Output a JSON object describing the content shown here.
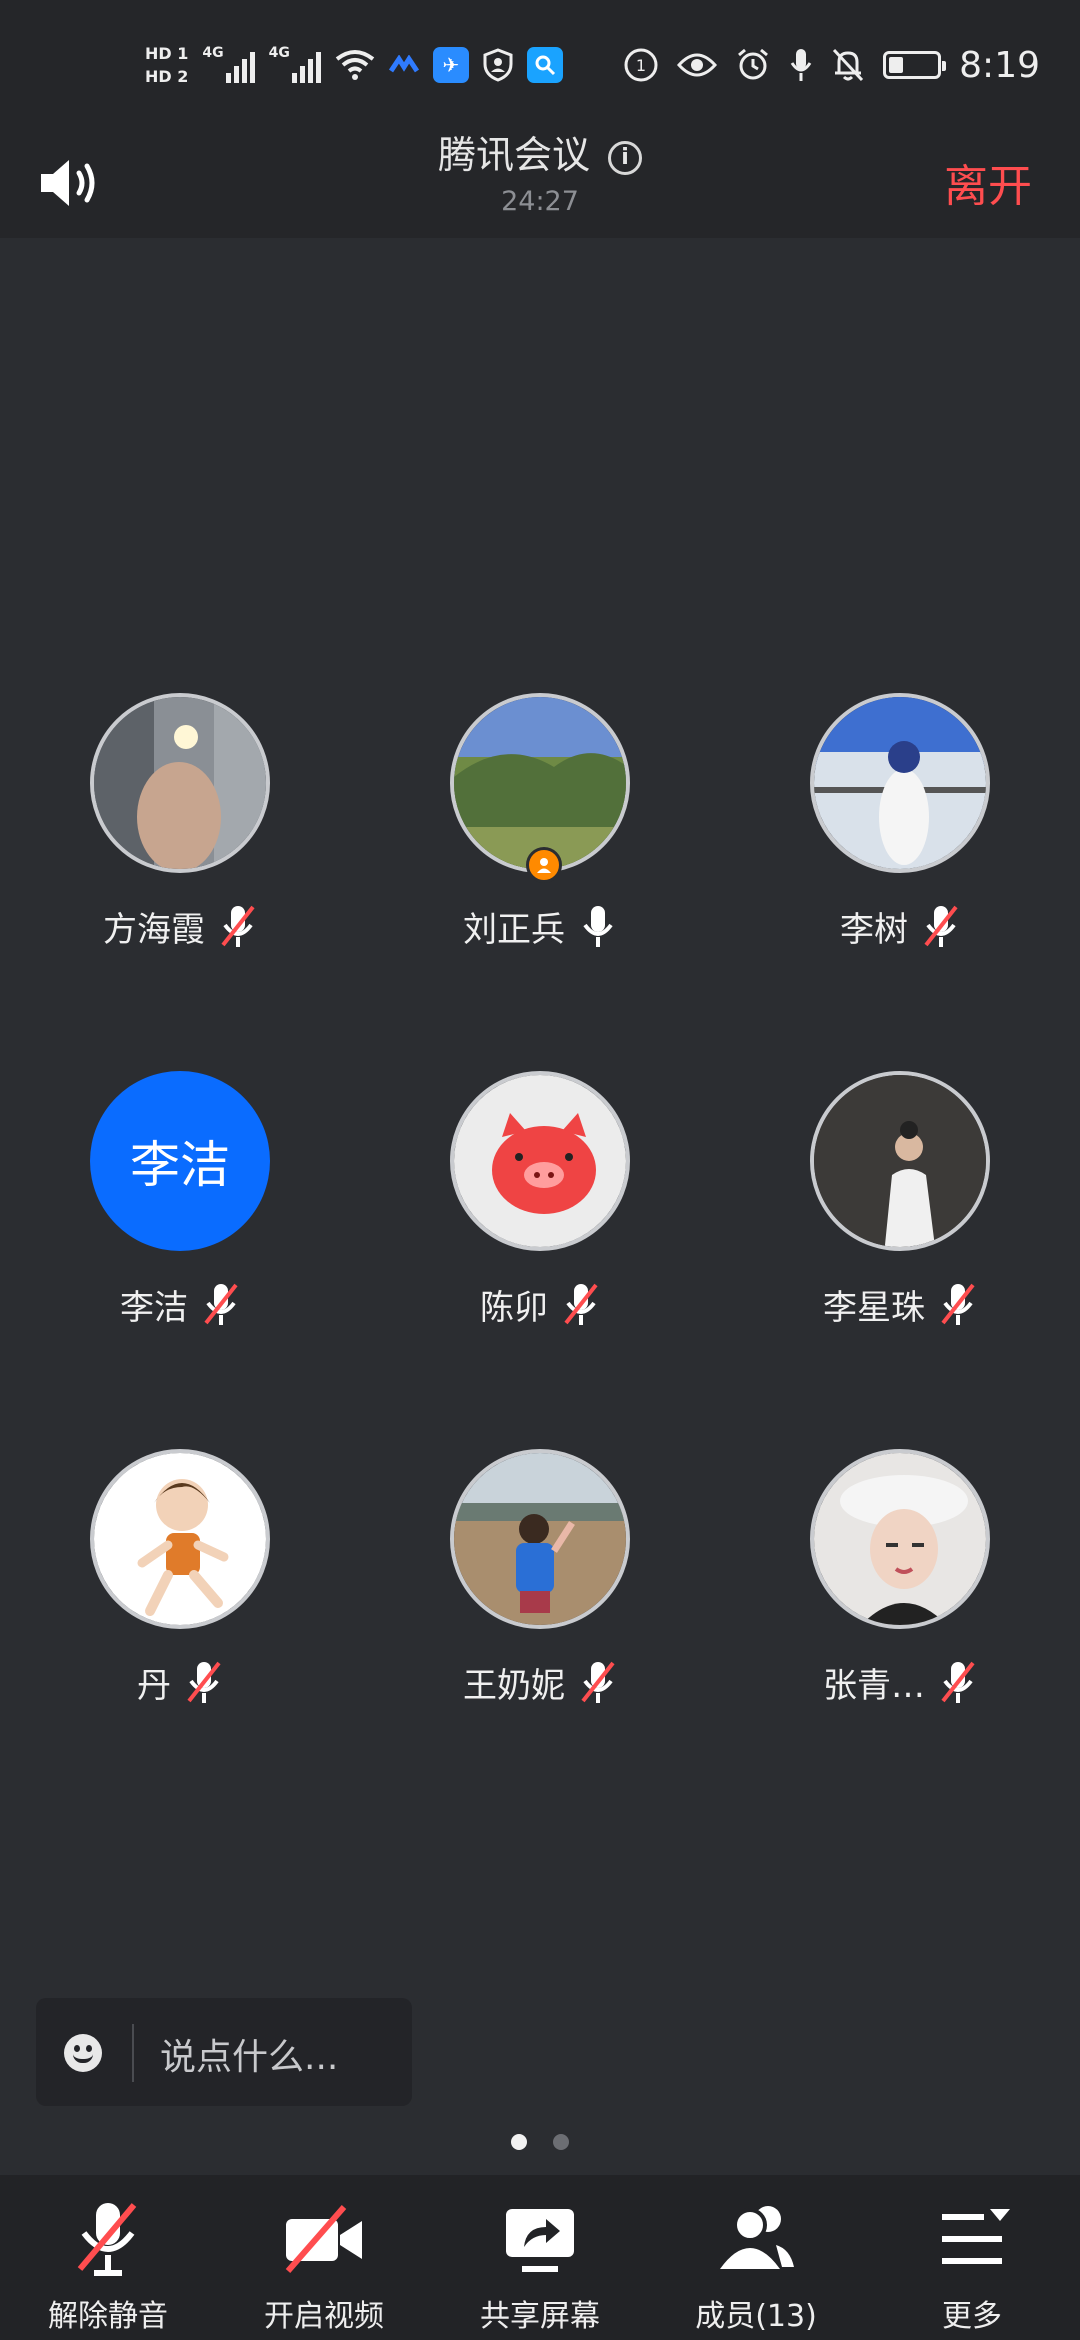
{
  "status_bar": {
    "hd1": "HD 1",
    "hd2": "HD 2",
    "net1": "4G",
    "net2": "4G",
    "time": "8:19",
    "battery_level": 0.3
  },
  "header": {
    "title": "腾讯会议",
    "info_glyph": "i",
    "timer": "24:27",
    "leave_label": "离开"
  },
  "participants": [
    {
      "name": "方海霞",
      "mic": "muted",
      "avatar": "photo"
    },
    {
      "name": "刘正兵",
      "mic": "on",
      "avatar": "photo",
      "host": true
    },
    {
      "name": "李树",
      "mic": "muted",
      "avatar": "photo"
    },
    {
      "name": "李洁",
      "mic": "muted",
      "avatar": "text",
      "avatar_text": "李洁"
    },
    {
      "name": "陈卯",
      "mic": "muted",
      "avatar": "photo"
    },
    {
      "name": "李星珠",
      "mic": "muted",
      "avatar": "photo"
    },
    {
      "name": "丹",
      "mic": "muted",
      "avatar": "photo"
    },
    {
      "name": "王奶妮",
      "mic": "muted",
      "avatar": "photo"
    },
    {
      "name": "张青…",
      "mic": "muted",
      "avatar": "photo"
    }
  ],
  "chat": {
    "placeholder": "说点什么..."
  },
  "pager": {
    "pages": 2,
    "current": 1
  },
  "toolbar": {
    "unmute_label": "解除静音",
    "video_label": "开启视频",
    "share_label": "共享屏幕",
    "members_label": "成员(13)",
    "more_label": "更多"
  },
  "colors": {
    "accent_red": "#ff4d4f",
    "avatar_blue": "#0a6cff",
    "host_orange": "#ff8a00"
  }
}
